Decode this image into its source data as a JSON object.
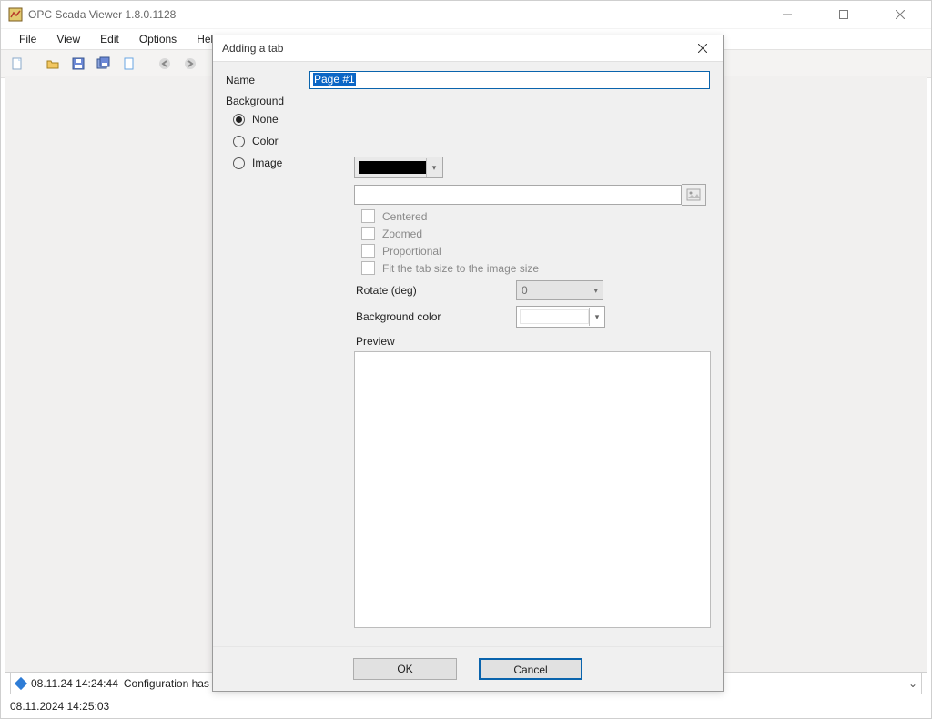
{
  "app": {
    "title": "OPC Scada Viewer 1.8.0.1128"
  },
  "menu": {
    "items": [
      "File",
      "View",
      "Edit",
      "Options",
      "Help"
    ]
  },
  "toolbar_icons": [
    "new-doc-icon",
    "open-folder-icon",
    "save-icon",
    "save-all-icon",
    "new-tab-icon",
    "back-icon",
    "forward-icon",
    "help-icon"
  ],
  "log": {
    "timestamp": "08.11.24 14:24:44",
    "message": "Configuration has been loaded successfully"
  },
  "status": {
    "datetime": "08.11.2024 14:25:03"
  },
  "dialog": {
    "title": "Adding a tab",
    "name_label": "Name",
    "name_value": "Page #1",
    "background_label": "Background",
    "options": {
      "none": "None",
      "color": "Color",
      "image": "Image"
    },
    "selected_option": "none",
    "color_value": "#000000",
    "image_path": "",
    "checkboxes": {
      "centered": "Centered",
      "zoomed": "Zoomed",
      "proportional": "Proportional",
      "fit": "Fit the tab size to the image size"
    },
    "rotate_label": "Rotate (deg)",
    "rotate_value": "0",
    "bgcolor_label": "Background color",
    "bgcolor_value": "#ffffff",
    "preview_label": "Preview",
    "buttons": {
      "ok": "OK",
      "cancel": "Cancel"
    }
  }
}
